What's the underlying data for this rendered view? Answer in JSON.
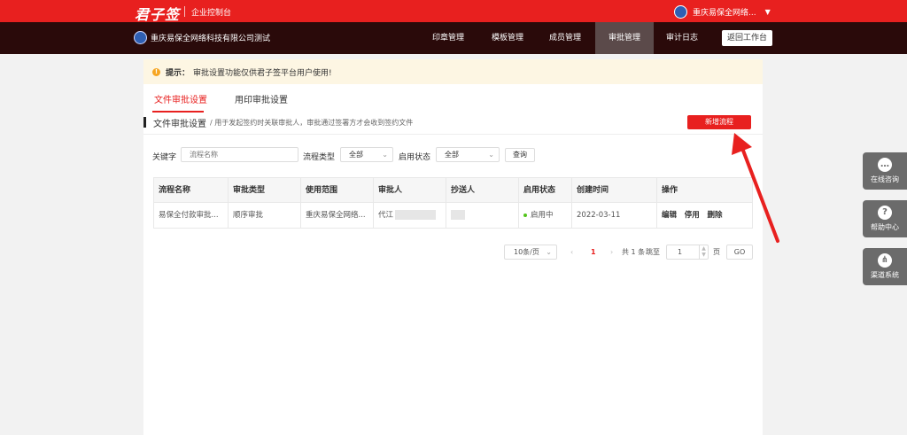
{
  "topbar": {
    "logo": "君子签",
    "subtitle": "企业控制台",
    "user_name": "重庆易保全网络...",
    "caret": "▼"
  },
  "navbar": {
    "org_name": "重庆易保全网络科技有限公司测试",
    "items": [
      {
        "label": "印章管理",
        "active": false
      },
      {
        "label": "模板管理",
        "active": false
      },
      {
        "label": "成员管理",
        "active": false
      },
      {
        "label": "审批管理",
        "active": true
      },
      {
        "label": "审计日志",
        "active": false
      }
    ],
    "back_label": "返回工作台"
  },
  "notice": {
    "label": "提示：",
    "text": "审批设置功能仅供君子签平台用户使用!"
  },
  "tabs": [
    {
      "label": "文件审批设置",
      "active": true
    },
    {
      "label": "用印审批设置",
      "active": false
    }
  ],
  "section": {
    "title": "文件审批设置",
    "desc": "/ 用于发起签约时关联审批人，审批通过签署方才会收到签约文件",
    "new_button": "新增流程"
  },
  "filters": {
    "keyword_label": "关键字",
    "keyword_placeholder": "流程名称",
    "type_label": "流程类型",
    "type_value": "全部",
    "status_label": "启用状态",
    "status_value": "全部",
    "query_label": "查询"
  },
  "table": {
    "columns": [
      "流程名称",
      "审批类型",
      "使用范围",
      "审批人",
      "抄送人",
      "启用状态",
      "创建时间",
      "操作"
    ],
    "rows": [
      {
        "name": "易保全付款审批...",
        "type": "顺序审批",
        "scope": "重庆易保全网络...",
        "approver": "代江",
        "cc": "",
        "status": "启用中",
        "created": "2022-03-11",
        "actions": [
          "编辑",
          "停用",
          "删除"
        ]
      }
    ]
  },
  "pagination": {
    "page_size": "10条/页",
    "current_page": "1",
    "total_text": "共 1 条",
    "jump_label": "跳至",
    "jump_value": "1",
    "page_unit": "页",
    "go_label": "GO"
  },
  "float_menu": [
    {
      "label": "在线咨询",
      "icon": "chat-icon"
    },
    {
      "label": "帮助中心",
      "icon": "help-icon"
    },
    {
      "label": "渠道系统",
      "icon": "org-chart-icon"
    }
  ],
  "colors": {
    "brand_red": "#e8201f",
    "nav_dark": "#2a0a0a",
    "nav_active": "#5b4a4a",
    "status_green": "#52c41a"
  }
}
